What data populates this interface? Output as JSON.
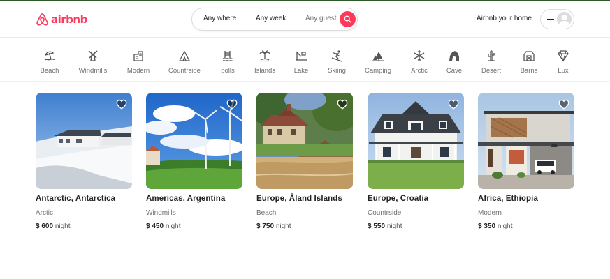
{
  "brand": {
    "name": "airbnb",
    "color": "#ff385c",
    "logo_icon": "airbnb-logo-icon"
  },
  "search": {
    "where": "Any where",
    "week": "Any week",
    "guest": "Any guest",
    "button_icon": "search-icon"
  },
  "header": {
    "host_link": "Airbnb your home",
    "menu_icon": "hamburger-icon",
    "avatar_icon": "user-avatar-icon"
  },
  "categories": [
    {
      "label": "Beach",
      "icon": "beach-umbrella-icon"
    },
    {
      "label": "Windmills",
      "icon": "windmill-icon"
    },
    {
      "label": "Modern",
      "icon": "modern-house-icon"
    },
    {
      "label": "Countrside",
      "icon": "tent-icon"
    },
    {
      "label": "polls",
      "icon": "pool-icon"
    },
    {
      "label": "Islands",
      "icon": "palm-island-icon"
    },
    {
      "label": "Lake",
      "icon": "lake-icon"
    },
    {
      "label": "Skiing",
      "icon": "skiing-icon"
    },
    {
      "label": "Camping",
      "icon": "camping-trees-icon"
    },
    {
      "label": "Arctic",
      "icon": "snowflake-icon"
    },
    {
      "label": "Cave",
      "icon": "cave-icon"
    },
    {
      "label": "Desert",
      "icon": "cactus-icon"
    },
    {
      "label": "Barns",
      "icon": "barn-icon"
    },
    {
      "label": "Lux",
      "icon": "diamond-icon"
    }
  ],
  "listings": [
    {
      "title": "Antarctic, Antarctica",
      "category": "Arctic",
      "price": "$ 600",
      "per": "night"
    },
    {
      "title": "Americas, Argentina",
      "category": "Windmills",
      "price": "$ 450",
      "per": "night"
    },
    {
      "title": "Europe, Åland Islands",
      "category": "Beach",
      "price": "$ 750",
      "per": "night"
    },
    {
      "title": "Europe, Croatia",
      "category": "Countrside",
      "price": "$ 550",
      "per": "night"
    },
    {
      "title": "Africa, Ethiopia",
      "category": "Modern",
      "price": "$ 350",
      "per": "night"
    }
  ],
  "photo_sign": "225"
}
